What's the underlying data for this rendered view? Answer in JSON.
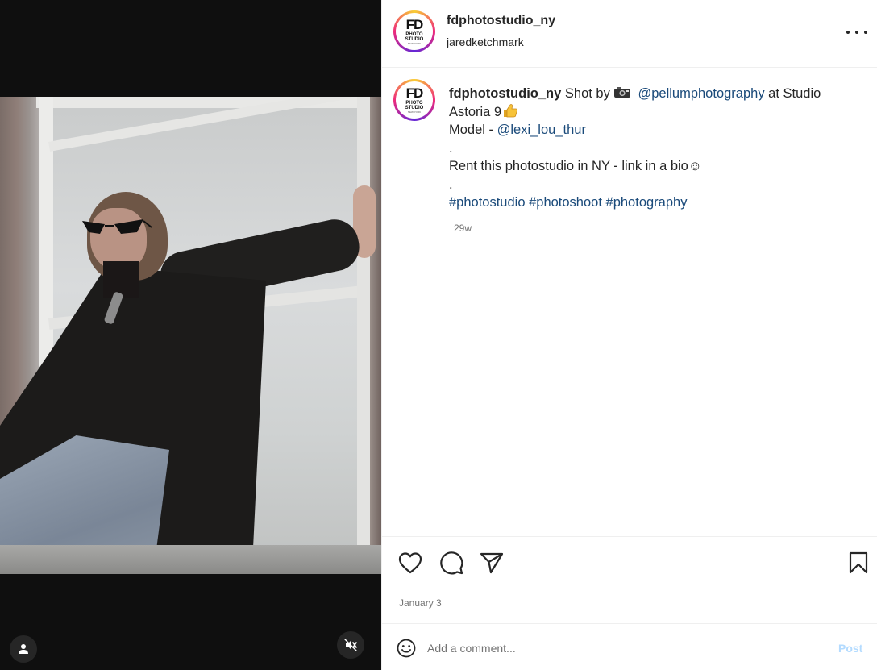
{
  "post": {
    "username": "fdphotostudio_ny",
    "tagged_user": "jaredketchmark",
    "avatar_logo": {
      "line1": "FD",
      "line2": "PHOTO",
      "line3": "STUDIO",
      "line4": "NEW YORK"
    },
    "caption": {
      "username": "fdphotostudio_ny",
      "part1": "Shot by",
      "camera_icon": "camera-emoji",
      "mention_photographer": "@pellumphotography",
      "part2": "at Studio Astoria 9",
      "thumbs_icon": "thumbs-up-emoji",
      "model_label": "Model -",
      "mention_model": "@lexi_lou_thur",
      "dot1": ".",
      "rent_text": "Rent this photostudio in NY - link in a bio",
      "smile_glyph": "☺",
      "dot2": ".",
      "hashtags": [
        "#photostudio",
        "#photoshoot",
        "#photography"
      ]
    },
    "caption_time": "29w",
    "date": "January 3"
  },
  "composer": {
    "placeholder": "Add a comment...",
    "post_label": "Post"
  },
  "icons": {
    "more": "more-options-icon",
    "like": "heart-icon",
    "comment": "comment-bubble-icon",
    "share": "paper-plane-icon",
    "save": "bookmark-icon",
    "emoji": "smiley-icon",
    "user_tag": "person-icon",
    "mute": "muted-speaker-icon"
  },
  "colors": {
    "link": "#1a4a7a",
    "text": "#262626",
    "muted": "#737373",
    "post_button_disabled": "#b3dbff",
    "media_background": "#0f0f0f"
  }
}
